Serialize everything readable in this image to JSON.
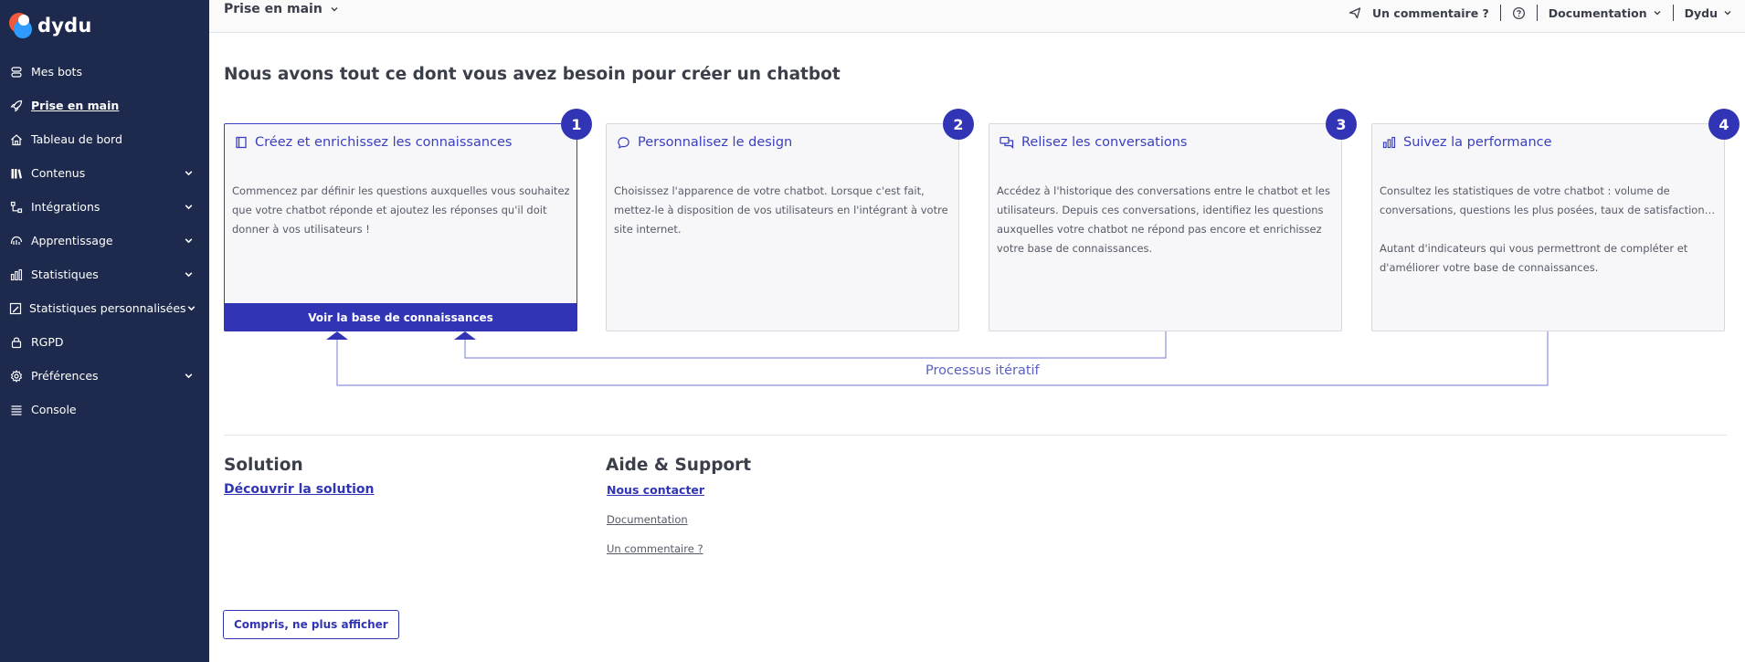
{
  "brand": {
    "name": "dydu"
  },
  "sidebar": {
    "items": [
      {
        "label": "Mes bots",
        "icon": "bots-icon",
        "expandable": false,
        "active": false
      },
      {
        "label": "Prise en main",
        "icon": "rocket-icon",
        "expandable": false,
        "active": true
      },
      {
        "label": "Tableau de bord",
        "icon": "home-icon",
        "expandable": false,
        "active": false
      },
      {
        "label": "Contenus",
        "icon": "library-icon",
        "expandable": true,
        "active": false
      },
      {
        "label": "Intégrations",
        "icon": "integrations-icon",
        "expandable": true,
        "active": false
      },
      {
        "label": "Apprentissage",
        "icon": "learning-icon",
        "expandable": true,
        "active": false
      },
      {
        "label": "Statistiques",
        "icon": "bar-chart-icon",
        "expandable": true,
        "active": false
      },
      {
        "label": "Statistiques personnalisées",
        "icon": "custom-stats-icon",
        "expandable": true,
        "active": false
      },
      {
        "label": "RGPD",
        "icon": "lock-icon",
        "expandable": false,
        "active": false
      },
      {
        "label": "Préférences",
        "icon": "gear-icon",
        "expandable": true,
        "active": false
      },
      {
        "label": "Console",
        "icon": "console-icon",
        "expandable": false,
        "active": false
      }
    ]
  },
  "topbar": {
    "title": "Prise en main",
    "comment": "Un commentaire ?",
    "documentation": "Documentation",
    "user": "Dydu"
  },
  "main": {
    "title": "Nous avons tout ce dont vous avez besoin pour créer un chatbot",
    "steps": [
      {
        "number": "1",
        "title": "Créez et enrichissez les connaissances",
        "icon": "book-icon",
        "paragraphs": [
          "Commencez par définir les questions auxquelles vous souhaitez que votre chatbot réponde et ajoutez les réponses qu'il doit donner à vos utilisateurs !"
        ],
        "button": "Voir la base de connaissances"
      },
      {
        "number": "2",
        "title": "Personnalisez le design",
        "icon": "chat-bubble-icon",
        "paragraphs": [
          "Choisissez l'apparence de votre chatbot. Lorsque c'est fait, mettez-le à disposition de vos utilisateurs en l'intégrant à votre site internet."
        ]
      },
      {
        "number": "3",
        "title": "Relisez les conversations",
        "icon": "conversations-icon",
        "paragraphs": [
          "Accédez à l'historique des conversations entre le chatbot et les utilisateurs. Depuis ces conversations, identifiez les questions auxquelles votre chatbot ne répond pas encore et enrichissez votre base de connaissances."
        ]
      },
      {
        "number": "4",
        "title": "Suivez la performance",
        "icon": "bar-chart-icon",
        "paragraphs": [
          "Consultez les statistiques de votre chatbot : volume de conversations, questions les plus posées, taux de satisfaction…",
          "Autant d'indicateurs qui vous permettront de compléter et d'améliorer votre base de connaissances."
        ]
      }
    ],
    "iterative_label": "Processus itératif"
  },
  "footer": {
    "solution_title": "Solution",
    "solution_link": "Découvrir la solution",
    "support_title": "Aide & Support",
    "support_links": [
      "Nous contacter",
      "Documentation",
      "Un commentaire ?"
    ],
    "dismiss": "Compris, ne plus afficher"
  },
  "colors": {
    "sidebar_bg": "#1d2a4d",
    "accent": "#3034b5",
    "card_bg": "#f7f7fa"
  }
}
